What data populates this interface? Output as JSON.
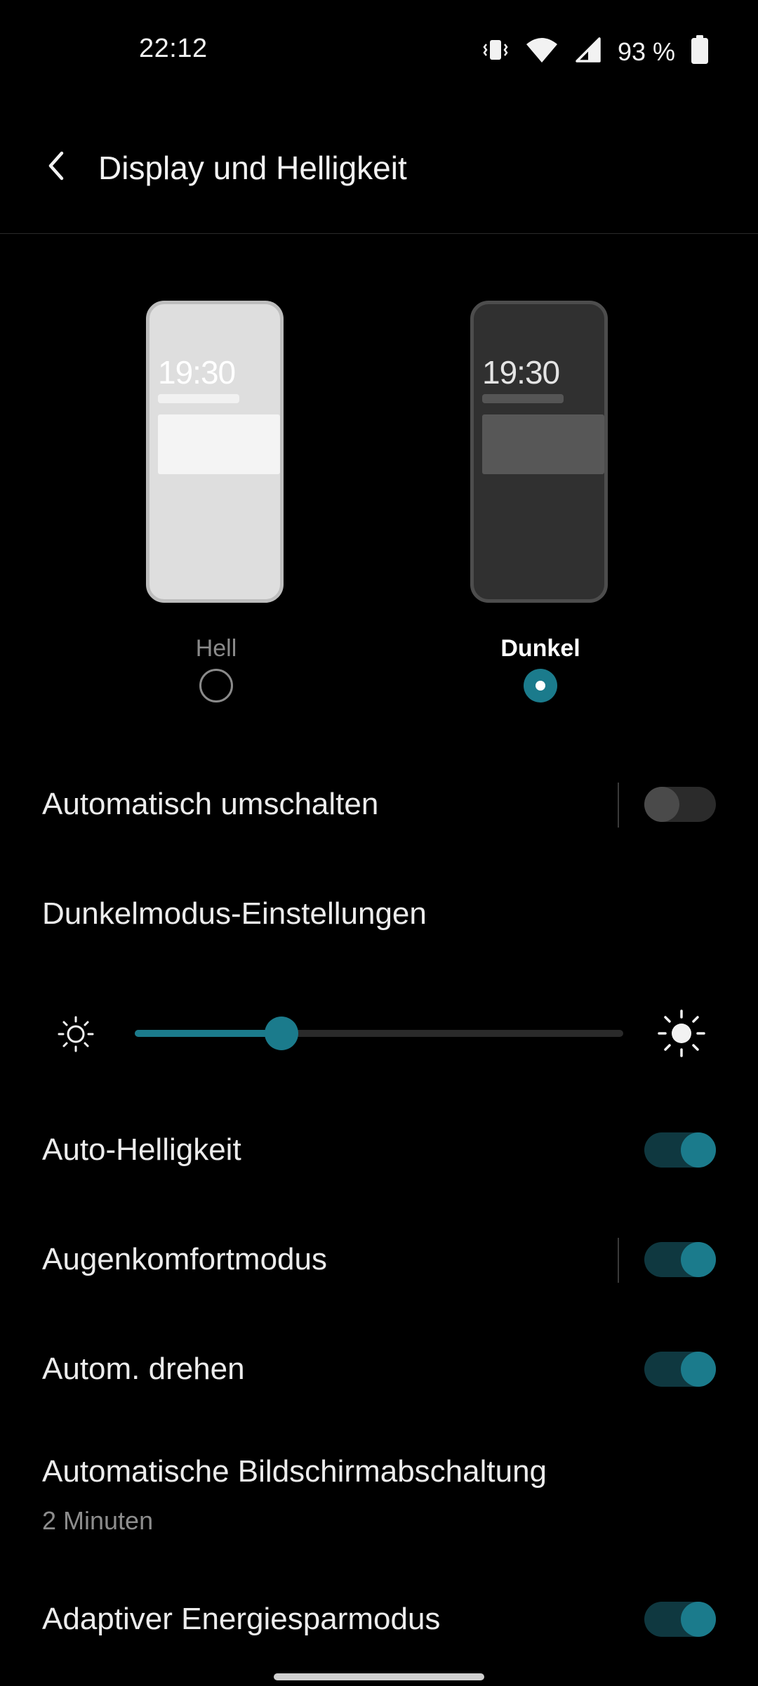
{
  "status_bar": {
    "time": "22:12",
    "battery_percent": "93 %",
    "icons": [
      "vibrate-icon",
      "wifi-icon",
      "cellular-signal-icon",
      "battery-icon"
    ]
  },
  "header": {
    "back_icon": "chevron-left-icon",
    "title": "Display und Helligkeit"
  },
  "theme": {
    "options": [
      {
        "label": "Hell",
        "preview_time": "19:30",
        "selected": false
      },
      {
        "label": "Dunkel",
        "preview_time": "19:30",
        "selected": true
      }
    ]
  },
  "settings": {
    "auto_switch": {
      "label": "Automatisch umschalten",
      "enabled": false
    },
    "dark_mode_settings": {
      "label": "Dunkelmodus-Einstellungen"
    },
    "brightness": {
      "level_fraction": 0.3,
      "min_icon": "sun-outline-icon",
      "max_icon": "sun-filled-icon"
    },
    "auto_brightness": {
      "label": "Auto-Helligkeit",
      "enabled": true
    },
    "eye_comfort": {
      "label": "Augenkomfortmodus",
      "enabled": true
    },
    "auto_rotate": {
      "label": "Autom. drehen",
      "enabled": true
    },
    "screen_timeout": {
      "label": "Automatische Bildschirmabschaltung",
      "value": "2 Minuten"
    },
    "adaptive_power": {
      "label": "Adaptiver Energiesparmodus",
      "enabled": true
    }
  },
  "colors": {
    "accent": "#1b7b8c",
    "toggle_track_on": "#0f3840",
    "background": "#000000"
  }
}
